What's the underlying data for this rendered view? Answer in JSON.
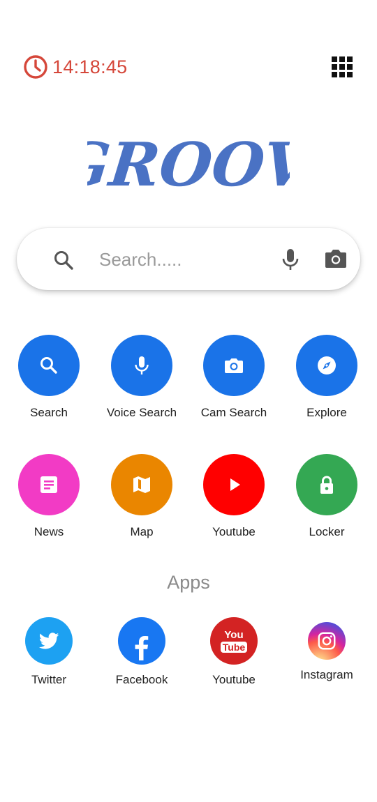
{
  "header": {
    "time": "14:18:45",
    "clock_color": "#d5473a"
  },
  "logo": {
    "text": "GROOV",
    "color": "#4a72c4"
  },
  "search": {
    "placeholder": "Search.....",
    "value": ""
  },
  "shortcuts": [
    {
      "label": "Search",
      "icon": "search-icon",
      "color": "#1a73e8"
    },
    {
      "label": "Voice Search",
      "icon": "mic-icon",
      "color": "#1a73e8"
    },
    {
      "label": "Cam Search",
      "icon": "camera-icon",
      "color": "#1a73e8"
    },
    {
      "label": "Explore",
      "icon": "compass-icon",
      "color": "#1a73e8"
    },
    {
      "label": "News",
      "icon": "news-icon",
      "color": "#f23bc5"
    },
    {
      "label": "Map",
      "icon": "map-icon",
      "color": "#ea8600"
    },
    {
      "label": "Youtube",
      "icon": "play-icon",
      "color": "#ff0000"
    },
    {
      "label": "Locker",
      "icon": "lock-icon",
      "color": "#34a853"
    }
  ],
  "apps_section": {
    "title": "Apps",
    "items": [
      {
        "label": "Twitter",
        "icon": "twitter-icon",
        "color": "#1da1f2"
      },
      {
        "label": "Facebook",
        "icon": "facebook-icon",
        "color": "#1877f2"
      },
      {
        "label": "Youtube",
        "icon": "youtube-app-icon",
        "color": "#d32323",
        "badge_top": "You",
        "badge_bottom": "Tube"
      },
      {
        "label": "Instagram",
        "icon": "instagram-icon",
        "color": "#c13584"
      }
    ]
  }
}
